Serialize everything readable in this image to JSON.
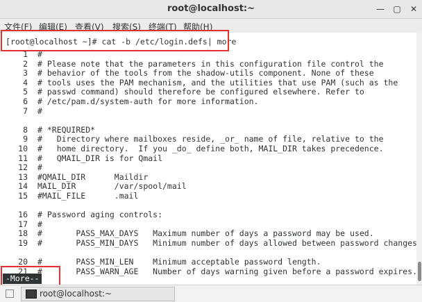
{
  "window": {
    "title": "root@localhost:~"
  },
  "menu": [
    "文件(F)",
    "编辑(E)",
    "查看(V)",
    "搜索(S)",
    "终端(T)",
    "帮助(H)"
  ],
  "prompt": {
    "user_host": "root@localhost ~",
    "symbol": "]#",
    "command": "cat -b /etc/login.defs| more"
  },
  "lines": [
    {
      "n": "1",
      "t": "#"
    },
    {
      "n": "2",
      "t": "# Please note that the parameters in this configuration file control the"
    },
    {
      "n": "3",
      "t": "# behavior of the tools from the shadow-utils component. None of these"
    },
    {
      "n": "4",
      "t": "# tools uses the PAM mechanism, and the utilities that use PAM (such as the"
    },
    {
      "n": "5",
      "t": "# passwd command) should therefore be configured elsewhere. Refer to"
    },
    {
      "n": "6",
      "t": "# /etc/pam.d/system-auth for more information."
    },
    {
      "n": "7",
      "t": "#"
    },
    {
      "n": "",
      "t": ""
    },
    {
      "n": "8",
      "t": "# *REQUIRED*"
    },
    {
      "n": "9",
      "t": "#   Directory where mailboxes reside, _or_ name of file, relative to the"
    },
    {
      "n": "10",
      "t": "#   home directory.  If you _do_ define both, MAIL_DIR takes precedence."
    },
    {
      "n": "11",
      "t": "#   QMAIL_DIR is for Qmail"
    },
    {
      "n": "12",
      "t": "#"
    },
    {
      "n": "13",
      "t": "#QMAIL_DIR      Maildir"
    },
    {
      "n": "14",
      "t": "MAIL_DIR        /var/spool/mail"
    },
    {
      "n": "15",
      "t": "#MAIL_FILE      .mail"
    },
    {
      "n": "",
      "t": ""
    },
    {
      "n": "16",
      "t": "# Password aging controls:"
    },
    {
      "n": "17",
      "t": "#"
    },
    {
      "n": "18",
      "t": "#       PASS_MAX_DAYS   Maximum number of days a password may be used."
    },
    {
      "n": "19",
      "t": "#       PASS_MIN_DAYS   Minimum number of days allowed between password changes"
    },
    {
      "n": "",
      "t": ""
    },
    {
      "n": "20",
      "t": "#       PASS_MIN_LEN    Minimum acceptable password length."
    },
    {
      "n": "21",
      "t": "#       PASS_WARN_AGE   Number of days warning given before a password expires."
    }
  ],
  "more_prompt": "-More--",
  "taskbar": {
    "item": "root@localhost:~"
  },
  "highlight_color": "#e03030"
}
